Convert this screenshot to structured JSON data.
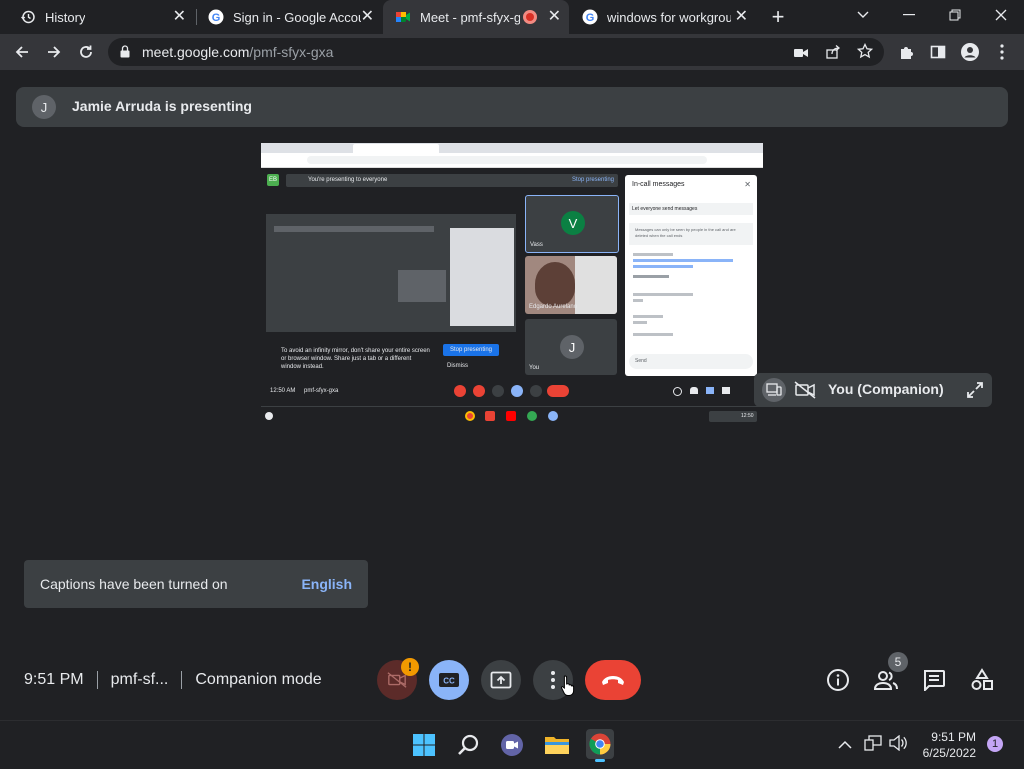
{
  "browser": {
    "tabs": [
      {
        "title": "History",
        "icon": "history-icon",
        "active": false
      },
      {
        "title": "Sign in - Google Accou",
        "icon": "google-icon",
        "active": false
      },
      {
        "title": "Meet - pmf-sfyx-g",
        "icon": "meet-icon",
        "active": true
      },
      {
        "title": "windows for workgroup",
        "icon": "google-icon",
        "active": false
      }
    ],
    "url_host": "meet.google.com",
    "url_path": "/pmf-sfyx-gxa"
  },
  "meet": {
    "presenter_initial": "J",
    "presenting_text": "Jamie Arruda is presenting",
    "companion_label": "You (Companion)",
    "captions_message": "Captions have been turned on",
    "captions_language": "English",
    "time": "9:51 PM",
    "meeting_code": "pmf-sf...",
    "mode": "Companion mode",
    "camera_alert": "!",
    "participant_count": "5"
  },
  "shared_screen": {
    "presenting_notice": "You're presenting to everyone",
    "stop_label": "Stop presenting",
    "panel_title": "In-call messages",
    "panel_toggle": "Let everyone send messages",
    "panel_note": "Messages can only be seen by people in the call and are deleted when the call ends",
    "panel_input": "Send",
    "tiles": [
      {
        "initial": "V",
        "name": "Vass",
        "color": "#0b8043"
      },
      {
        "initial": "",
        "name": "Edgardo Aurelano",
        "color": "#8d6e63"
      },
      {
        "initial": "J",
        "name": "You",
        "color": "#5f6368"
      }
    ],
    "mirror_warning": "To avoid an infinity mirror, don't share your entire screen or browser window. Share just a tab or a different window instead.",
    "mirror_button": "Stop presenting",
    "mirror_dismiss": "Dismiss",
    "time": "12:50 AM",
    "code": "pmf-sfyx-gxa",
    "mini_clock": "12:50"
  },
  "taskbar": {
    "time": "9:51 PM",
    "date": "6/25/2022",
    "notification_count": "1"
  },
  "colors": {
    "end_call": "#ea4335",
    "accent": "#8ab4f8",
    "alert": "#f29900"
  }
}
